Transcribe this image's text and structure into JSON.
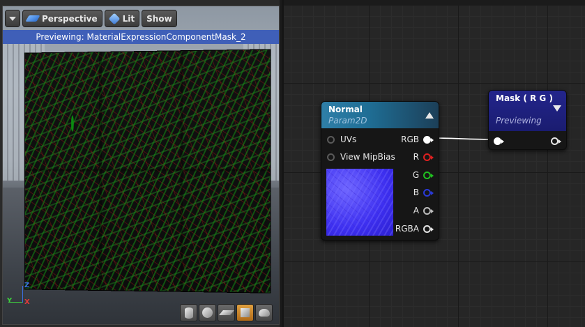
{
  "viewport": {
    "toolbar": {
      "menu_icon": "chevron-down-icon",
      "perspective_label": "Perspective",
      "lit_label": "Lit",
      "show_label": "Show"
    },
    "preview_banner": "Previewing: MaterialExpressionComponentMask_2",
    "axis": {
      "z": "Z",
      "y": "Y",
      "x": "X"
    },
    "shape_buttons": [
      {
        "name": "cylinder",
        "icon": "cylinder-icon",
        "active": false
      },
      {
        "name": "sphere",
        "icon": "sphere-icon",
        "active": false
      },
      {
        "name": "plane",
        "icon": "plane-icon",
        "active": false
      },
      {
        "name": "cube",
        "icon": "cube-icon",
        "active": true
      },
      {
        "name": "teapot",
        "icon": "teapot-icon",
        "active": false
      }
    ]
  },
  "graph": {
    "nodes": {
      "normal": {
        "title": "Normal",
        "subtitle": "Param2D",
        "inputs": [
          "UVs",
          "View MipBias"
        ],
        "outputs": [
          "RGB",
          "R",
          "G",
          "B",
          "A",
          "RGBA"
        ]
      },
      "mask": {
        "title": "Mask ( R G )",
        "subtitle": "Previewing"
      }
    }
  },
  "colors": {
    "header_normal": "#1f6e95",
    "header_mask": "#1a1c70",
    "preview_banner": "#3f5fb8",
    "pin_r": "#e02020",
    "pin_g": "#20c020",
    "pin_b": "#2a3ad8",
    "active_shape": "#e0a040"
  }
}
